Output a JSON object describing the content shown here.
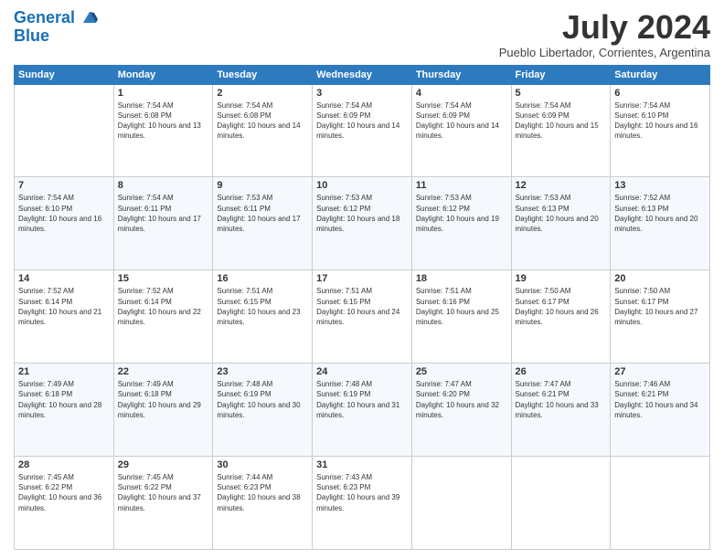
{
  "header": {
    "logo_line1": "General",
    "logo_line2": "Blue",
    "month_year": "July 2024",
    "location": "Pueblo Libertador, Corrientes, Argentina"
  },
  "columns": [
    "Sunday",
    "Monday",
    "Tuesday",
    "Wednesday",
    "Thursday",
    "Friday",
    "Saturday"
  ],
  "weeks": [
    [
      {
        "day": "",
        "sunrise": "",
        "sunset": "",
        "daylight": ""
      },
      {
        "day": "1",
        "sunrise": "Sunrise: 7:54 AM",
        "sunset": "Sunset: 6:08 PM",
        "daylight": "Daylight: 10 hours and 13 minutes."
      },
      {
        "day": "2",
        "sunrise": "Sunrise: 7:54 AM",
        "sunset": "Sunset: 6:08 PM",
        "daylight": "Daylight: 10 hours and 14 minutes."
      },
      {
        "day": "3",
        "sunrise": "Sunrise: 7:54 AM",
        "sunset": "Sunset: 6:09 PM",
        "daylight": "Daylight: 10 hours and 14 minutes."
      },
      {
        "day": "4",
        "sunrise": "Sunrise: 7:54 AM",
        "sunset": "Sunset: 6:09 PM",
        "daylight": "Daylight: 10 hours and 14 minutes."
      },
      {
        "day": "5",
        "sunrise": "Sunrise: 7:54 AM",
        "sunset": "Sunset: 6:09 PM",
        "daylight": "Daylight: 10 hours and 15 minutes."
      },
      {
        "day": "6",
        "sunrise": "Sunrise: 7:54 AM",
        "sunset": "Sunset: 6:10 PM",
        "daylight": "Daylight: 10 hours and 16 minutes."
      }
    ],
    [
      {
        "day": "7",
        "sunrise": "Sunrise: 7:54 AM",
        "sunset": "Sunset: 6:10 PM",
        "daylight": "Daylight: 10 hours and 16 minutes."
      },
      {
        "day": "8",
        "sunrise": "Sunrise: 7:54 AM",
        "sunset": "Sunset: 6:11 PM",
        "daylight": "Daylight: 10 hours and 17 minutes."
      },
      {
        "day": "9",
        "sunrise": "Sunrise: 7:53 AM",
        "sunset": "Sunset: 6:11 PM",
        "daylight": "Daylight: 10 hours and 17 minutes."
      },
      {
        "day": "10",
        "sunrise": "Sunrise: 7:53 AM",
        "sunset": "Sunset: 6:12 PM",
        "daylight": "Daylight: 10 hours and 18 minutes."
      },
      {
        "day": "11",
        "sunrise": "Sunrise: 7:53 AM",
        "sunset": "Sunset: 6:12 PM",
        "daylight": "Daylight: 10 hours and 19 minutes."
      },
      {
        "day": "12",
        "sunrise": "Sunrise: 7:53 AM",
        "sunset": "Sunset: 6:13 PM",
        "daylight": "Daylight: 10 hours and 20 minutes."
      },
      {
        "day": "13",
        "sunrise": "Sunrise: 7:52 AM",
        "sunset": "Sunset: 6:13 PM",
        "daylight": "Daylight: 10 hours and 20 minutes."
      }
    ],
    [
      {
        "day": "14",
        "sunrise": "Sunrise: 7:52 AM",
        "sunset": "Sunset: 6:14 PM",
        "daylight": "Daylight: 10 hours and 21 minutes."
      },
      {
        "day": "15",
        "sunrise": "Sunrise: 7:52 AM",
        "sunset": "Sunset: 6:14 PM",
        "daylight": "Daylight: 10 hours and 22 minutes."
      },
      {
        "day": "16",
        "sunrise": "Sunrise: 7:51 AM",
        "sunset": "Sunset: 6:15 PM",
        "daylight": "Daylight: 10 hours and 23 minutes."
      },
      {
        "day": "17",
        "sunrise": "Sunrise: 7:51 AM",
        "sunset": "Sunset: 6:15 PM",
        "daylight": "Daylight: 10 hours and 24 minutes."
      },
      {
        "day": "18",
        "sunrise": "Sunrise: 7:51 AM",
        "sunset": "Sunset: 6:16 PM",
        "daylight": "Daylight: 10 hours and 25 minutes."
      },
      {
        "day": "19",
        "sunrise": "Sunrise: 7:50 AM",
        "sunset": "Sunset: 6:17 PM",
        "daylight": "Daylight: 10 hours and 26 minutes."
      },
      {
        "day": "20",
        "sunrise": "Sunrise: 7:50 AM",
        "sunset": "Sunset: 6:17 PM",
        "daylight": "Daylight: 10 hours and 27 minutes."
      }
    ],
    [
      {
        "day": "21",
        "sunrise": "Sunrise: 7:49 AM",
        "sunset": "Sunset: 6:18 PM",
        "daylight": "Daylight: 10 hours and 28 minutes."
      },
      {
        "day": "22",
        "sunrise": "Sunrise: 7:49 AM",
        "sunset": "Sunset: 6:18 PM",
        "daylight": "Daylight: 10 hours and 29 minutes."
      },
      {
        "day": "23",
        "sunrise": "Sunrise: 7:48 AM",
        "sunset": "Sunset: 6:19 PM",
        "daylight": "Daylight: 10 hours and 30 minutes."
      },
      {
        "day": "24",
        "sunrise": "Sunrise: 7:48 AM",
        "sunset": "Sunset: 6:19 PM",
        "daylight": "Daylight: 10 hours and 31 minutes."
      },
      {
        "day": "25",
        "sunrise": "Sunrise: 7:47 AM",
        "sunset": "Sunset: 6:20 PM",
        "daylight": "Daylight: 10 hours and 32 minutes."
      },
      {
        "day": "26",
        "sunrise": "Sunrise: 7:47 AM",
        "sunset": "Sunset: 6:21 PM",
        "daylight": "Daylight: 10 hours and 33 minutes."
      },
      {
        "day": "27",
        "sunrise": "Sunrise: 7:46 AM",
        "sunset": "Sunset: 6:21 PM",
        "daylight": "Daylight: 10 hours and 34 minutes."
      }
    ],
    [
      {
        "day": "28",
        "sunrise": "Sunrise: 7:45 AM",
        "sunset": "Sunset: 6:22 PM",
        "daylight": "Daylight: 10 hours and 36 minutes."
      },
      {
        "day": "29",
        "sunrise": "Sunrise: 7:45 AM",
        "sunset": "Sunset: 6:22 PM",
        "daylight": "Daylight: 10 hours and 37 minutes."
      },
      {
        "day": "30",
        "sunrise": "Sunrise: 7:44 AM",
        "sunset": "Sunset: 6:23 PM",
        "daylight": "Daylight: 10 hours and 38 minutes."
      },
      {
        "day": "31",
        "sunrise": "Sunrise: 7:43 AM",
        "sunset": "Sunset: 6:23 PM",
        "daylight": "Daylight: 10 hours and 39 minutes."
      },
      {
        "day": "",
        "sunrise": "",
        "sunset": "",
        "daylight": ""
      },
      {
        "day": "",
        "sunrise": "",
        "sunset": "",
        "daylight": ""
      },
      {
        "day": "",
        "sunrise": "",
        "sunset": "",
        "daylight": ""
      }
    ]
  ]
}
